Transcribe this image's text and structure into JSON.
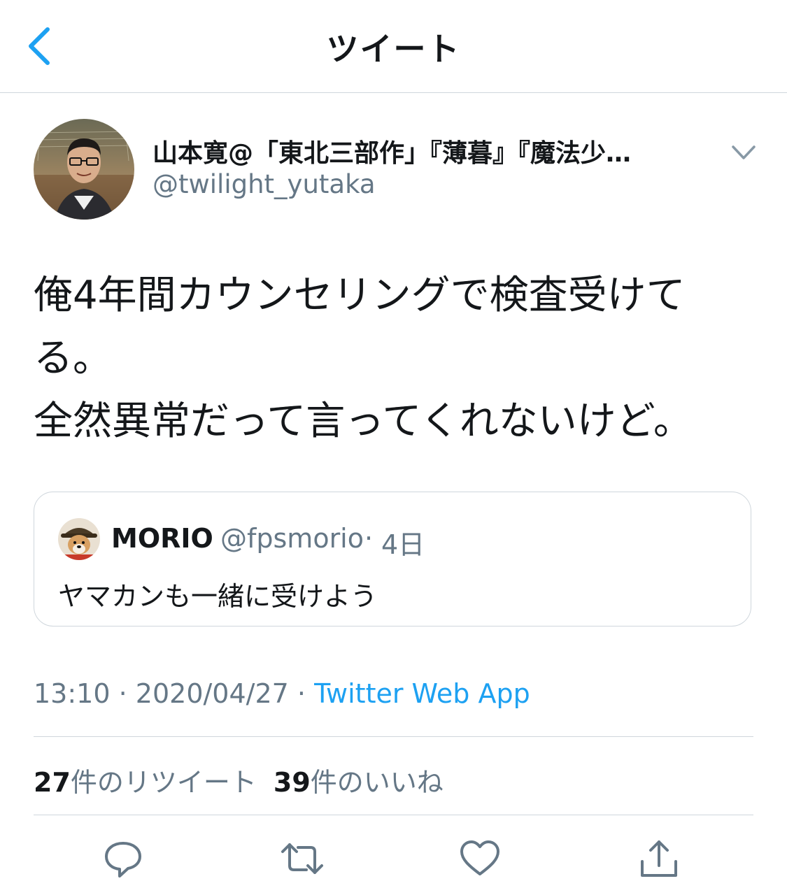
{
  "header": {
    "title": "ツイート"
  },
  "tweet": {
    "display_name": "山本寛@「東北三部作」『薄暮』『魔法少…",
    "handle": "@twilight_yutaka",
    "text_lines": [
      "俺4年間カウンセリングで検査受けて",
      "る。",
      "全然異常だって言ってくれないけど。"
    ],
    "time": "13:10",
    "date": "2020/04/27",
    "separator": "·",
    "source": "Twitter Web App"
  },
  "quote": {
    "name": "MORIO",
    "handle": "@fpsmorio",
    "separator": "·",
    "time": "4日",
    "text": "ヤマカンも一緒に受けよう"
  },
  "stats": {
    "retweet_count": "27",
    "retweet_label": "件のリツイート",
    "like_count": "39",
    "like_label": "件のいいね"
  },
  "icons": {
    "back": "chevron-left-icon",
    "more": "chevron-down-icon",
    "reply": "reply-icon",
    "retweet": "retweet-icon",
    "like": "heart-icon",
    "share": "share-icon"
  },
  "colors": {
    "accent": "#1da1f2",
    "text": "#14171a",
    "secondary": "#657786",
    "border": "#cfd6dc"
  }
}
